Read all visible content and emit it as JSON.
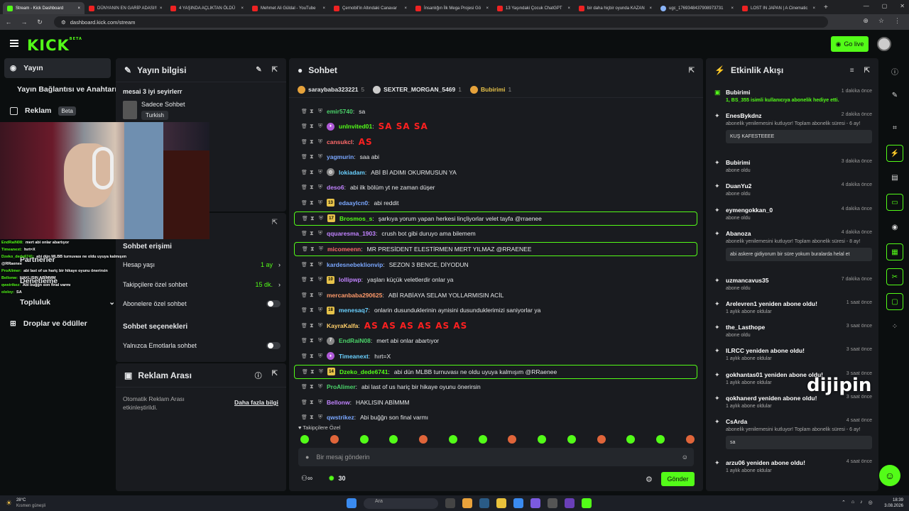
{
  "browser": {
    "tabs": [
      {
        "label": "Stream - Kick Dashboard",
        "active": true
      },
      {
        "label": "DÜNYANIN EN GARİP ADASI!!"
      },
      {
        "label": "4 YAŞINDA AÇLIKTAN ÖLDÜ"
      },
      {
        "label": "Mehmet Ali Güldal - YouTube"
      },
      {
        "label": "Çernobil'in Altındaki Canavar"
      },
      {
        "label": "İnsanlığın İlk Mega Projesi Gö"
      },
      {
        "label": "13 Yaşındaki Çocuk ChatGPT"
      },
      {
        "label": "bir daha hiçbir oyunda KAZAN"
      },
      {
        "label": "ugc_1769348437908973731"
      },
      {
        "label": "LOST IN JAPAN | A Cinematic"
      }
    ],
    "url": "dashboard.kick.com/stream"
  },
  "header": {
    "logo": "KICK",
    "logo_sup": "BETA",
    "go_live": "Go live"
  },
  "sidebar": {
    "items": [
      {
        "label": "Yayın",
        "active": true
      },
      {
        "label": "Yayın Bağlantısı ve Anahtarı"
      },
      {
        "label": "Reklam",
        "badge": "Beta"
      },
      {
        "label": "Partnerler"
      },
      {
        "label": "Denetleme"
      },
      {
        "label": "Topluluk"
      },
      {
        "label": "Droplar ve ödüller"
      }
    ]
  },
  "stream_info": {
    "title": "Yayın bilgisi",
    "stream_title": "mesai 3 iyi seyirlerr",
    "category": "Sadece Sohbet",
    "language": "Turkish"
  },
  "chat_access": {
    "title": "Sohbet erişimi",
    "rows": [
      {
        "label": "Hesap yaşı",
        "value": "1 ay"
      },
      {
        "label": "Takipçilere özel sohbet",
        "value": "15 dk."
      },
      {
        "label": "Abonelere özel sohbet",
        "value": ""
      }
    ],
    "options_title": "Sohbet seçenekleri",
    "emotes_only": "Yalnızca Emotlarla sohbet"
  },
  "ad_break": {
    "title": "Reklam Arası",
    "desc": "Otomatik Reklam Arası etkinleştirildi.",
    "link": "Daha fazla bilgi"
  },
  "chat": {
    "title": "Sohbet",
    "pinned": [
      {
        "name": "saraybaba323221",
        "count": "5"
      },
      {
        "name": "SEXTER_MORGAN_5469",
        "count": "1"
      },
      {
        "name": "Bubirimi",
        "count": "1"
      }
    ],
    "messages": [
      {
        "user": "emir5740",
        "color": "#4bd36a",
        "text": "sa"
      },
      {
        "user": "unInvited01",
        "color": "#53fc18",
        "text": "SA SA SA",
        "big": true,
        "badge": "p"
      },
      {
        "user": "cansukcl",
        "color": "#ff6a6a",
        "text": "AS",
        "big": true
      },
      {
        "user": "yagmurin",
        "color": "#7aa7ff",
        "text": "saa abi"
      },
      {
        "user": "lokiadam",
        "color": "#6ad0ff",
        "text": "ABİ Bİ ADIMI OKURMUSUN YA",
        "badge": "g"
      },
      {
        "user": "deso6",
        "color": "#c183ff",
        "text": "abi ilk bölüm yt ne zaman düşer"
      },
      {
        "user": "edaaylcn0",
        "color": "#7aa7ff",
        "text": "abi reddit",
        "badge": "13"
      },
      {
        "user": "Brosmos_s",
        "color": "#53fc18",
        "text": "şarkıya yorum yapan herkesi linçliyorlar velet tayfa @rraenee",
        "badge": "17",
        "hl": true
      },
      {
        "user": "qquaresma_1903",
        "color": "#c183ff",
        "text": "crush bot gibi duruyo ama bilemem"
      },
      {
        "user": "micomeenn",
        "color": "#ff6a6a",
        "text": "MR PRESİDENT ELESTİRMEN MERT YILMAZ @RRAENEE",
        "hl": true
      },
      {
        "user": "kardesnebeklionvip",
        "color": "#7aa7ff",
        "text": "SEZON 3 BENCE, DİYODUN"
      },
      {
        "user": "lollipwp",
        "color": "#c183ff",
        "text": "yaşları küçük veletlerdir onlar ya",
        "badge": "10"
      },
      {
        "user": "mercanbaba290625",
        "color": "#ff9a6a",
        "text": "ABİ RABİAYA SELAM YOLLARMISIN ACİL"
      },
      {
        "user": "menesaq7",
        "color": "#6ad0ff",
        "text": "onlarin dusunduklerinin aynisini dusunduklerimizi saniyorlar ya",
        "badge": "18"
      },
      {
        "user": "KayraKalfa",
        "color": "#ffcf6a",
        "text": "AS AS AS AS AS AS",
        "big": true
      },
      {
        "user": "EndRaiN08",
        "color": "#4bd36a",
        "text": "mert abi onlar abartıyor",
        "badge": "g7"
      },
      {
        "user": "Timeanext",
        "color": "#6ad0ff",
        "text": "hırt=X",
        "badge": "p"
      },
      {
        "user": "Dzeko_dede6741",
        "color": "#53fc18",
        "text": "abi dün MLBB turnuvası ne oldu uyuya kalmışım @RRaenee",
        "badge": "14",
        "hl": true
      },
      {
        "user": "ProAlimer",
        "color": "#4bd36a",
        "text": "abi last of us hariç bir hikaye oyunu önerirsin"
      },
      {
        "user": "Bellonw",
        "color": "#c183ff",
        "text": "HAKLISIN ABİMMM"
      },
      {
        "user": "qwstrikez",
        "color": "#7aa7ff",
        "text": "Abi buğğn son final varmı"
      }
    ],
    "emote_tab": "Takipçilere Özel",
    "placeholder": "Bir mesaj gönderin",
    "count": "30",
    "send": "Gönder"
  },
  "overlay_chat": [
    {
      "n": "EndRaiN08:",
      "t": "mert abi onlar abartıyor"
    },
    {
      "n": "Timeanext:",
      "t": "hırt=X"
    },
    {
      "n": "Dzeko_dede6741:",
      "t": "abi dün MLBB turnuvası ne oldu uyuya kalmışım @RRaenee"
    },
    {
      "n": "ProAlimer:",
      "t": "abi last of us hariç bir hikaye oyunu önerirsin"
    },
    {
      "n": "Bellonw:",
      "t": "HAKLISIN ABİMMM"
    },
    {
      "n": "qwstrikez:",
      "t": "Abi buğğn son final varmı"
    },
    {
      "n": "ololoy:",
      "t": "SA"
    }
  ],
  "activity": {
    "title": "Etkinlik Akışı",
    "items": [
      {
        "name": "Bubirimi",
        "time": "1 dakika önce",
        "sub": "1, BS_355 isimli kullanıcıya abonelik hediye etti."
      },
      {
        "name": "EnesBykdnz",
        "time": "2 dakika önce",
        "sub": "abonelik yenilemesini kutluyor! Toplam abonelik süresi - 6 ay!",
        "quote": "KUŞ KAFESTEEEE"
      },
      {
        "name": "Bubirimi",
        "time": "3 dakika önce",
        "sub": "abone oldu"
      },
      {
        "name": "DuanYu2",
        "time": "4 dakika önce",
        "sub": "abone oldu"
      },
      {
        "name": "eymengokkan_0",
        "time": "4 dakika önce",
        "sub": "abone oldu"
      },
      {
        "name": "Abanoza",
        "time": "4 dakika önce",
        "sub": "abonelik yenilemesini kutluyor! Toplam abonelik süresi - 8 ay!",
        "quote": "abi askere gidiyorum bir süre yokum buralarda helal et"
      },
      {
        "name": "uzmancavus35",
        "time": "7 dakika önce",
        "sub": "abone oldu"
      },
      {
        "name": "Arelevren1 yeniden abone oldu!",
        "time": "1 saat önce",
        "sub": "1 aylık abone oldular"
      },
      {
        "name": "the_Lasthope",
        "time": "3 saat önce",
        "sub": "abone oldu"
      },
      {
        "name": "ILRCC yeniden abone oldu!",
        "time": "3 saat önce",
        "sub": "1 aylık abone oldular"
      },
      {
        "name": "gokhantas01 yeniden abone oldu!",
        "time": "3 saat önce",
        "sub": "1 aylık abone oldular"
      },
      {
        "name": "qokhanerd yeniden abone oldu!",
        "time": "3 saat önce",
        "sub": "1 aylık abone oldular"
      },
      {
        "name": "CsArda",
        "time": "4 saat önce",
        "sub": "abonelik yenilemesini kutluyor! Toplam abonelik süresi - 6 ay!",
        "quote": "sa"
      },
      {
        "name": "arzu06 yeniden abone oldu!",
        "time": "4 saat önce",
        "sub": "1 aylık abone oldular"
      }
    ]
  },
  "watermark": "dijipin",
  "taskbar": {
    "weather_temp": "28°C",
    "weather_desc": "Kısmen güneşli",
    "search": "Ara",
    "time": "18:39",
    "date": "3.08.2026"
  }
}
